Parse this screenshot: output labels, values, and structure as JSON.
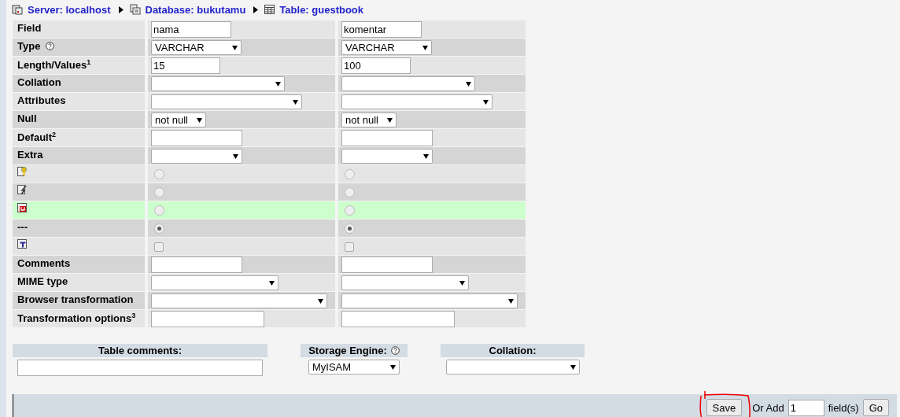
{
  "breadcrumb": [
    {
      "kind": "server",
      "text": "Server: localhost"
    },
    {
      "kind": "database",
      "text": "Database: bukutamu"
    },
    {
      "kind": "table",
      "text": "Table: guestbook"
    }
  ],
  "rows": [
    {
      "label": "Field",
      "kind": "text",
      "cells": [
        {
          "value": "nama"
        },
        {
          "value": "komentar"
        }
      ]
    },
    {
      "label": "Type",
      "help": true,
      "kind": "select",
      "cells": [
        {
          "value": "VARCHAR"
        },
        {
          "value": "VARCHAR"
        }
      ]
    },
    {
      "label": "Length/Values$^{1}$",
      "kind": "text",
      "cells": [
        {
          "value": "15"
        },
        {
          "value": "100"
        }
      ]
    },
    {
      "label": "Collation",
      "kind": "select",
      "cells": [
        {},
        {}
      ]
    },
    {
      "label": "Attributes",
      "kind": "select",
      "cells": [
        {},
        {}
      ]
    },
    {
      "label": "Null",
      "kind": "select",
      "cells": [
        {
          "value": "not null"
        },
        {
          "value": "not null"
        }
      ]
    },
    {
      "label": "Default$^{2}$",
      "kind": "text",
      "cells": [
        {},
        {}
      ]
    },
    {
      "label": "Extra",
      "kind": "select",
      "cells": [
        {},
        {}
      ]
    },
    {
      "kind": "radio",
      "highlighted": false,
      "cells": [
        {
          "selected": false
        },
        {
          "selected": false
        }
      ]
    },
    {
      "kind": "radio",
      "highlighted": false,
      "cells": [
        {
          "selected": false
        },
        {
          "selected": false
        }
      ]
    },
    {
      "kind": "radio",
      "highlighted": true,
      "cells": [
        {
          "selected": false
        },
        {
          "selected": false
        }
      ]
    },
    {
      "label": "---",
      "kind": "radio",
      "highlighted": false,
      "cells": [
        {
          "selected": true
        },
        {
          "selected": true
        }
      ]
    },
    {
      "kind": "checkbox",
      "cells": [
        {
          "checked": false
        },
        {
          "checked": false
        }
      ]
    },
    {
      "label": "Comments",
      "kind": "text",
      "cells": [
        {},
        {}
      ]
    },
    {
      "label": "MIME type",
      "kind": "select",
      "cells": [
        {},
        {}
      ]
    },
    {
      "label": "Browser transformation",
      "kind": "select",
      "cells": [
        {},
        {}
      ]
    },
    {
      "label": "Transformation options$^{3}$",
      "kind": "text",
      "cells": [
        {},
        {}
      ]
    }
  ],
  "table_options": {
    "comments_label": "Table comments:",
    "engine_label": "Storage Engine:",
    "engine_help": true,
    "engine": "MyISAM",
    "collation_label": "Collation:"
  },
  "footer": {
    "save": "Save",
    "or_add": "Or Add",
    "count": "1",
    "fields": "field(s)",
    "go": "Go",
    "annotated": true
  }
}
